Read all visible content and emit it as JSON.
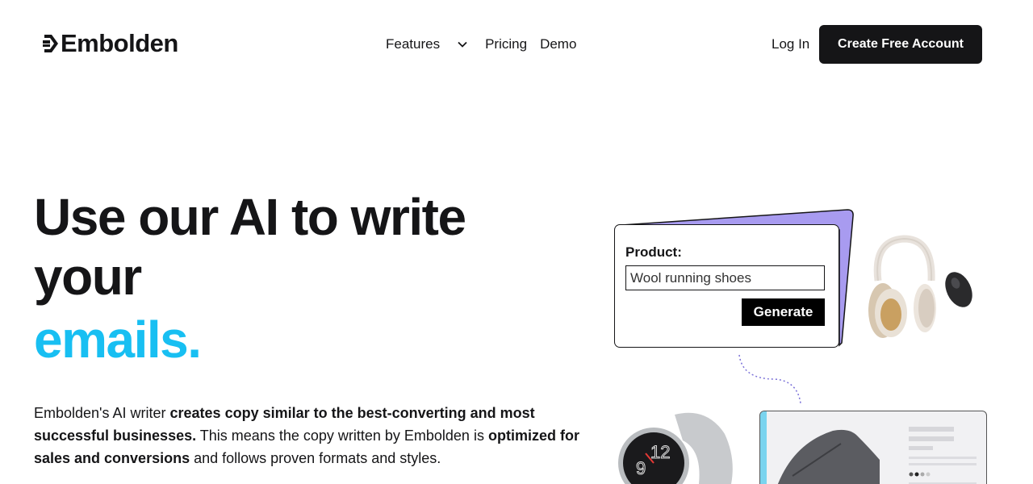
{
  "header": {
    "logo_text": "Embolden",
    "nav": {
      "features": "Features",
      "pricing": "Pricing",
      "demo": "Demo"
    },
    "login": "Log In",
    "cta": "Create Free Account"
  },
  "hero": {
    "title_line1": "Use our AI to write",
    "title_line2": "your",
    "title_accent": "emails.",
    "desc": {
      "p1": "Embolden's AI writer ",
      "b1": "creates copy similar to the best-converting and most successful businesses.",
      "p2": " This means the copy written by Embolden is ",
      "b2": "optimized for sales and conversions",
      "p3": " and follows proven formats and styles."
    }
  },
  "demo": {
    "label": "Product:",
    "input_value": "Wool running shoes",
    "button": "Generate"
  },
  "colors": {
    "accent": "#18bff2",
    "dark": "#151517",
    "card_back": "#a89bf0"
  },
  "icons": {
    "logo": "embolden-arrow-icon",
    "features_dropdown": "chevron-down-icon"
  }
}
